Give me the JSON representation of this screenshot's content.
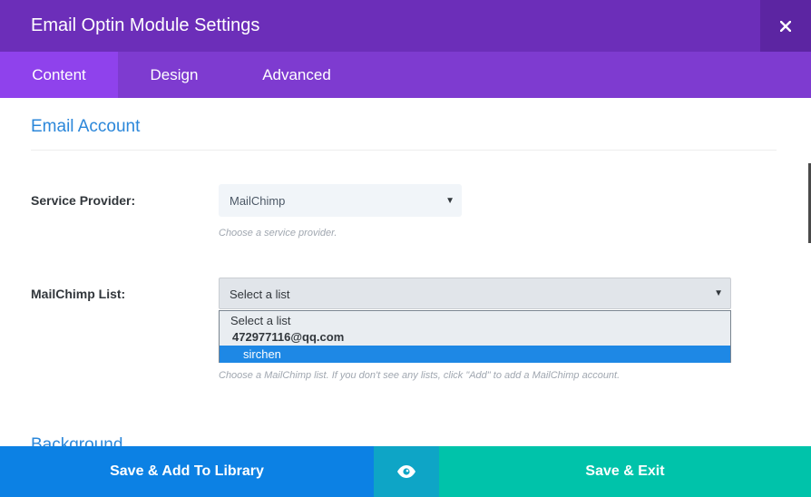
{
  "header": {
    "title": "Email Optin Module Settings",
    "close_icon": "close-icon"
  },
  "tabs": [
    {
      "label": "Content",
      "active": true
    },
    {
      "label": "Design",
      "active": false
    },
    {
      "label": "Advanced",
      "active": false
    }
  ],
  "section": {
    "title": "Email Account"
  },
  "service_provider": {
    "label": "Service Provider:",
    "value": "MailChimp",
    "help": "Choose a service provider."
  },
  "mailchimp_list": {
    "label": "MailChimp List:",
    "value": "Select a list",
    "options": {
      "default": "Select a list",
      "group": "472977116@qq.com",
      "selected": "sirchen"
    },
    "help": "Choose a MailChimp list. If you don't see any lists, click \"Add\" to add a MailChimp account."
  },
  "next_section": {
    "title": "Background"
  },
  "footer": {
    "save_library": "Save & Add To Library",
    "preview_icon": "eye-icon",
    "save_exit": "Save & Exit"
  },
  "colors": {
    "header": "#6c2eb9",
    "tabs": "#7e3bd0",
    "active_tab": "#8f42ec",
    "accent_blue": "#2b87da",
    "library_button": "#0c81e4",
    "preview_button": "#0ea5c6",
    "exit_button": "#00c3aa"
  }
}
